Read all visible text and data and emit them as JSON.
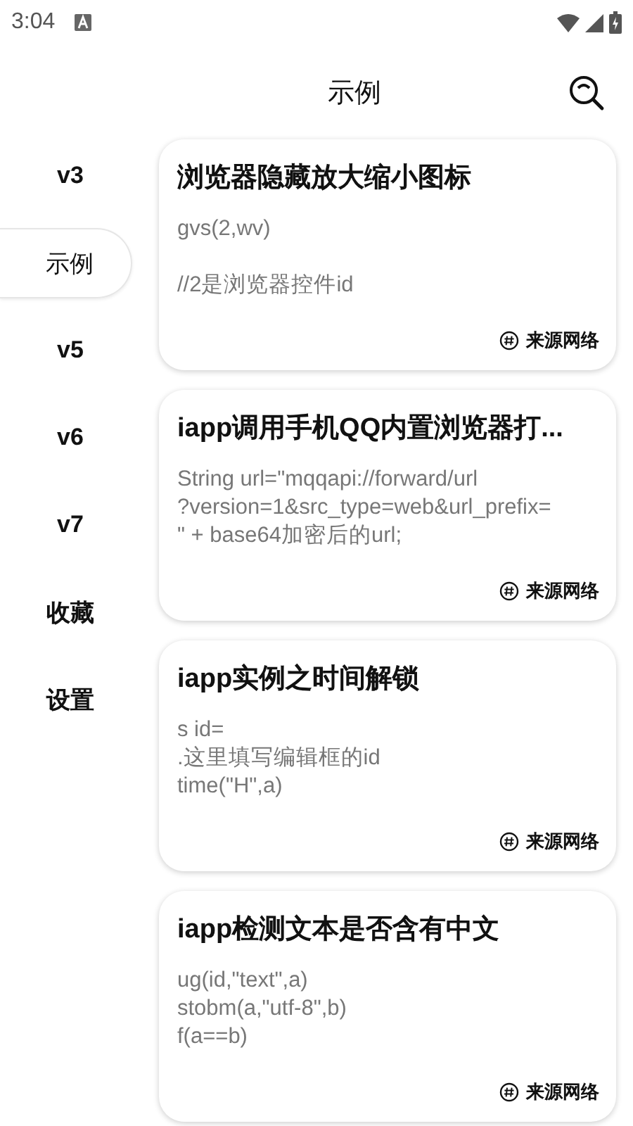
{
  "status_bar": {
    "time": "3:04"
  },
  "header": {
    "title": "示例"
  },
  "sidebar": {
    "items": [
      {
        "label": "v3",
        "selected": false
      },
      {
        "label": "示例",
        "selected": true
      },
      {
        "label": "v5",
        "selected": false
      },
      {
        "label": "v6",
        "selected": false
      },
      {
        "label": "v7",
        "selected": false
      },
      {
        "label": "收藏",
        "selected": false
      },
      {
        "label": "设置",
        "selected": false
      }
    ]
  },
  "cards": [
    {
      "title": "浏览器隐藏放大缩小图标",
      "paragraphs": [
        "gvs(2,wv)",
        "//2是浏览器控件id"
      ],
      "source": "来源网络"
    },
    {
      "title": "iapp调用手机QQ内置浏览器打...",
      "paragraphs": [
        "String url=\"mqqapi://forward/url\n?version=1&src_type=web&url_prefix=\n\" + base64加密后的url;"
      ],
      "source": "来源网络"
    },
    {
      "title": "iapp实例之时间解锁",
      "paragraphs": [
        "s id=\n.这里填写编辑框的id\ntime(\"H\",a)"
      ],
      "source": "来源网络"
    },
    {
      "title": "iapp检测文本是否含有中文",
      "paragraphs": [
        "ug(id,\"text\",a)\nstobm(a,\"utf-8\",b)\nf(a==b)"
      ],
      "source": "来源网络"
    }
  ]
}
